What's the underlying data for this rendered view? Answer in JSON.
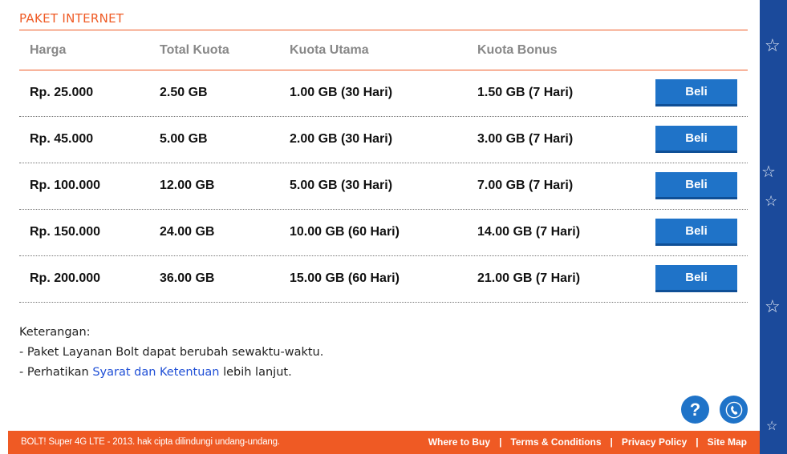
{
  "section_title": "PAKET INTERNET",
  "columns": [
    "Harga",
    "Total Kuota",
    "Kuota Utama",
    "Kuota Bonus"
  ],
  "rows": [
    {
      "harga": "Rp. 25.000",
      "total": "2.50 GB",
      "utama": "1.00 GB (30 Hari)",
      "bonus": "1.50 GB (7 Hari)",
      "button": "Beli"
    },
    {
      "harga": "Rp. 45.000",
      "total": "5.00 GB",
      "utama": "2.00 GB (30 Hari)",
      "bonus": "3.00 GB (7 Hari)",
      "button": "Beli"
    },
    {
      "harga": "Rp. 100.000",
      "total": "12.00 GB",
      "utama": "5.00 GB (30 Hari)",
      "bonus": "7.00 GB (7 Hari)",
      "button": "Beli"
    },
    {
      "harga": "Rp. 150.000",
      "total": "24.00 GB",
      "utama": "10.00 GB (60 Hari)",
      "bonus": "14.00 GB (7 Hari)",
      "button": "Beli"
    },
    {
      "harga": "Rp. 200.000",
      "total": "36.00 GB",
      "utama": "15.00 GB (60 Hari)",
      "bonus": "21.00 GB (7 Hari)",
      "button": "Beli"
    }
  ],
  "notes": {
    "heading": "Keterangan:",
    "line1": "- Paket Layanan Bolt dapat berubah sewaktu-waktu.",
    "line2_prefix": "- Perhatikan ",
    "line2_link": "Syarat dan Ketentuan",
    "line2_suffix": " lebih lanjut."
  },
  "help_button": "?",
  "footer": {
    "copyright": "BOLT! Super 4G LTE - 2013. hak cipta dilindungi undang-undang.",
    "links": [
      "Where to Buy",
      "Terms & Conditions",
      "Privacy Policy",
      "Site Map"
    ],
    "separator": "|"
  },
  "colors": {
    "accent": "#ef5a24",
    "button": "#1f73c8",
    "rail": "#1b4a9b",
    "link": "#1f4fd6"
  },
  "icons": [
    "help-icon",
    "phone-icon",
    "star-icon"
  ]
}
